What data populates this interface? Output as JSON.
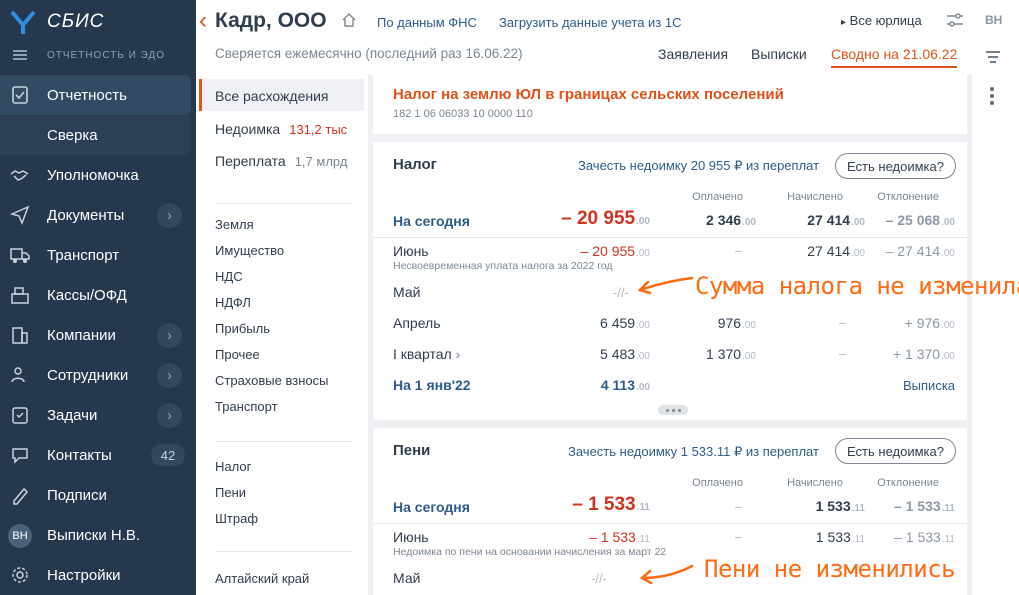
{
  "app": {
    "logo_text": "СБИС",
    "section": "ОТЧЕТНОСТЬ И ЭДО"
  },
  "nav": [
    {
      "label": "Отчетность",
      "icon": "report-icon",
      "state": "active"
    },
    {
      "label": "Сверка",
      "icon": "",
      "state": "sub"
    },
    {
      "label": "Уполномочка",
      "icon": "handshake-icon"
    },
    {
      "label": "Документы",
      "icon": "paper-plane-icon",
      "chevron": true
    },
    {
      "label": "Транспорт",
      "icon": "truck-icon"
    },
    {
      "label": "Кассы/ОФД",
      "icon": "cash-register-icon"
    },
    {
      "label": "Компании",
      "icon": "companies-icon",
      "chevron": true
    },
    {
      "label": "Сотрудники",
      "icon": "employees-icon",
      "chevron": true
    },
    {
      "label": "Задачи",
      "icon": "tasks-icon",
      "chevron": true
    },
    {
      "label": "Контакты",
      "icon": "chat-icon",
      "badge": "42"
    },
    {
      "label": "Подписи",
      "icon": "signature-icon"
    },
    {
      "label": "Выписки Н.В.",
      "icon": "avatar",
      "avatar": "ВН"
    },
    {
      "label": "Настройки",
      "icon": "gear-icon"
    }
  ],
  "header": {
    "title": "Кадр, ООО",
    "link_fns": "По данным ФНС",
    "link_1c": "Загрузить данные учета из 1С",
    "all_entities": "Все юрлица",
    "user_initials": "ВН",
    "subline": "Сверяется ежемесячно (последний раз 16.06.22)",
    "tabs": [
      "Заявления",
      "Выписки",
      "Сводно на 21.06.22"
    ],
    "active_tab": 2
  },
  "filters": {
    "all": "Все расхождения",
    "debt_label": "Недоимка",
    "debt_value": "131,2 тыс",
    "overpay_label": "Переплата",
    "overpay_value": "1,7 млрд",
    "types": [
      "Земля",
      "Имущество",
      "НДС",
      "НДФЛ",
      "Прибыль",
      "Прочее",
      "Страховые взносы",
      "Транспорт"
    ],
    "kinds": [
      "Налог",
      "Пени",
      "Штраф"
    ],
    "region": "Алтайский край"
  },
  "tax": {
    "title": "Налог на землю ЮЛ в границах сельских поселений",
    "code": "182 1 06 06033 10 0000 110"
  },
  "columns": {
    "paid": "Оплачено",
    "accrued": "Начислено",
    "deviation": "Отклонение"
  },
  "nalog": {
    "title": "Налог",
    "offset": "Зачесть недоимку 20 955 ₽ из переплат",
    "ask": "Есть недоимка?",
    "rows": [
      {
        "label": "На сегодня",
        "balance": "– 20 955",
        "balance_c": ".00",
        "paid": "2 346",
        "paid_c": ".00",
        "accrued": "27 414",
        "accrued_c": ".00",
        "dev": "– 25 068",
        "dev_c": ".00"
      },
      {
        "label": "Июнь",
        "note": "Несвоевременная уплата налога за 2022 год",
        "balance": "– 20 955",
        "balance_c": ".00",
        "paid": "–",
        "accrued": "27 414",
        "accrued_c": ".00",
        "dev": "– 27 414",
        "dev_c": ".00"
      },
      {
        "label": "Май",
        "balance": "-//-"
      },
      {
        "label": "Апрель",
        "balance": "6 459",
        "balance_c": ".00",
        "paid": "976",
        "paid_c": ".00",
        "accrued": "–",
        "dev": "+ 976",
        "dev_c": ".00"
      },
      {
        "label": "I квартал",
        "balance": "5 483",
        "balance_c": ".00",
        "paid": "1 370",
        "paid_c": ".00",
        "accrued": "–",
        "dev": "+ 1 370",
        "dev_c": ".00"
      },
      {
        "label": "На 1 янв'22",
        "balance": "4 113",
        "balance_c": ".00",
        "link": "Выписка"
      }
    ]
  },
  "peni": {
    "title": "Пени",
    "offset": "Зачесть недоимку 1 533.11 ₽ из переплат",
    "ask": "Есть недоимка?",
    "rows": [
      {
        "label": "На сегодня",
        "balance": "– 1 533",
        "balance_c": ".11",
        "paid": "–",
        "accrued": "1 533",
        "accrued_c": ".11",
        "dev": "– 1 533",
        "dev_c": ".11"
      },
      {
        "label": "Июнь",
        "note": "Недоимка по пени на основании начисления за март 22",
        "balance": "– 1 533",
        "balance_c": ".11",
        "paid": "–",
        "accrued": "1 533",
        "accrued_c": ".11",
        "dev": "– 1 533",
        "dev_c": ".11"
      },
      {
        "label": "Май",
        "balance": "-//-"
      }
    ]
  },
  "annotations": {
    "tax_unchanged": "Сумма налога не изменилась",
    "peni_unchanged": "Пени не изменились"
  },
  "colors": {
    "sidebar": "#26384d",
    "accent": "#e0521c",
    "annotation": "#ff6a13",
    "link": "#2f5c8a",
    "negative": "#d1321f"
  }
}
